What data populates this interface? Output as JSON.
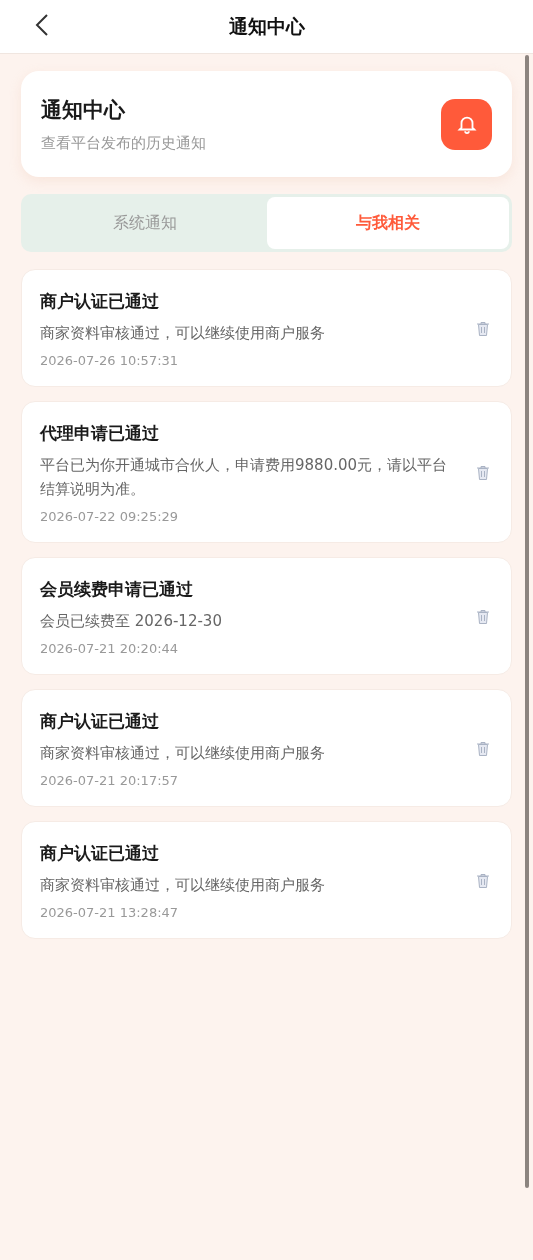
{
  "header": {
    "title": "通知中心"
  },
  "hero": {
    "title": "通知中心",
    "subtitle": "查看平台发布的历史通知"
  },
  "tabs": [
    {
      "label": "系统通知",
      "selected": false
    },
    {
      "label": "与我相关",
      "selected": true
    }
  ],
  "notifications": [
    {
      "title": "商户认证已通过",
      "body": "商家资料审核通过，可以继续使用商户服务",
      "time": "2026-07-26 10:57:31"
    },
    {
      "title": "代理申请已通过",
      "body": "平台已为你开通城市合伙人，申请费用9880.00元，请以平台结算说明为准。",
      "time": "2026-07-22 09:25:29"
    },
    {
      "title": "会员续费申请已通过",
      "body": "会员已续费至 2026-12-30",
      "time": "2026-07-21 20:20:44"
    },
    {
      "title": "商户认证已通过",
      "body": "商家资料审核通过，可以继续使用商户服务",
      "time": "2026-07-21 20:17:57"
    },
    {
      "title": "商户认证已通过",
      "body": "商家资料审核通过，可以继续使用商户服务",
      "time": "2026-07-21 13:28:47"
    }
  ]
}
